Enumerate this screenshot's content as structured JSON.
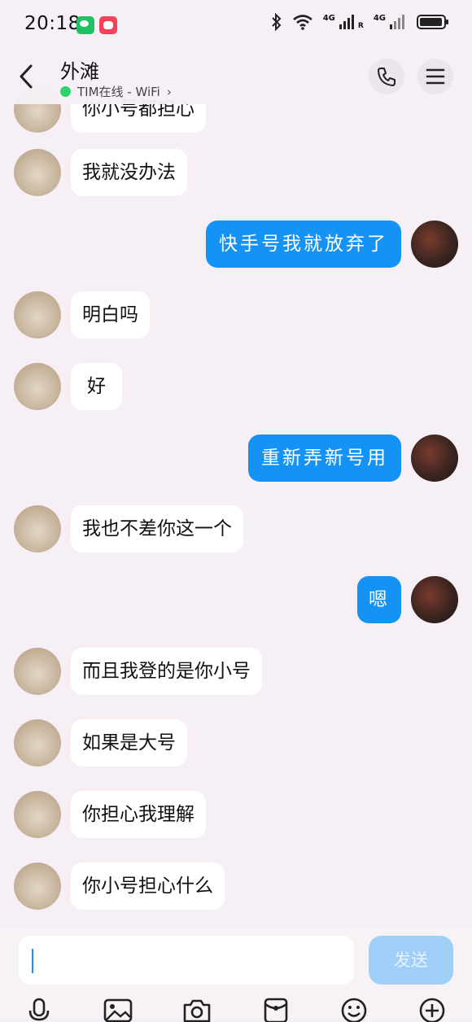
{
  "status": {
    "time": "20:18",
    "net1": "4G",
    "net2": "4G",
    "net1_sub": "R"
  },
  "header": {
    "title": "外滩",
    "subtitle": "TIM在线 - WiFi",
    "subtitle_arrow": "›"
  },
  "messages": [
    {
      "side": "left",
      "text": "你小号都担心"
    },
    {
      "side": "left",
      "text": "我就没办法"
    },
    {
      "side": "right",
      "text": "快手号我就放弃了"
    },
    {
      "side": "left",
      "text": "明白吗"
    },
    {
      "side": "left",
      "text": "好"
    },
    {
      "side": "right",
      "text": "重新弄新号用"
    },
    {
      "side": "left",
      "text": "我也不差你这一个"
    },
    {
      "side": "right",
      "text": "嗯"
    },
    {
      "side": "left",
      "text": "而且我登的是你小号"
    },
    {
      "side": "left",
      "text": "如果是大号"
    },
    {
      "side": "left",
      "text": "你担心我理解"
    },
    {
      "side": "left",
      "text": "你小号担心什么"
    }
  ],
  "composer": {
    "input_value": "",
    "send_label": "发送"
  },
  "toolbar": {
    "icons": [
      "microphone-icon",
      "image-icon",
      "camera-icon",
      "red-packet-icon",
      "emoji-icon",
      "plus-icon"
    ]
  },
  "colors": {
    "accent": "#1493f5",
    "online": "#2fd26b",
    "send_disabled": "#9fcff7"
  }
}
